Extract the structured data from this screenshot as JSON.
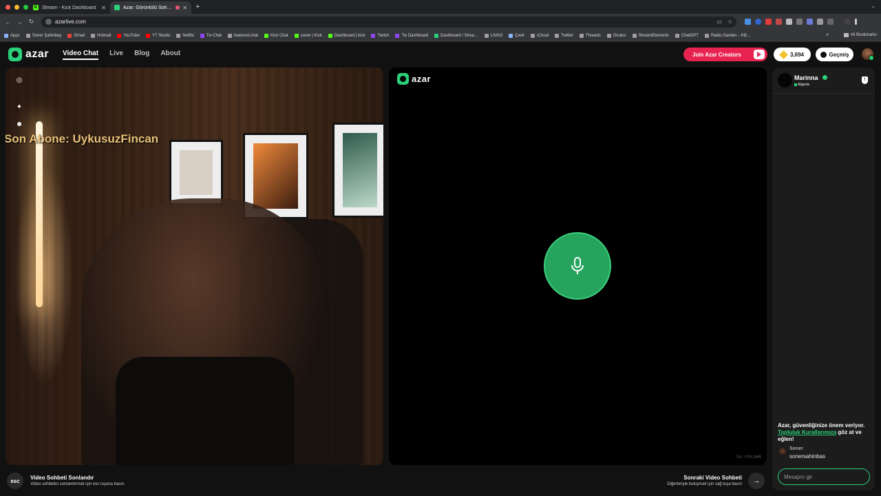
{
  "browser": {
    "tabs": [
      {
        "title": "Stream - Kick Dashboard",
        "favicon_color": "#53fc18",
        "favicon_letter": "K",
        "active": false
      },
      {
        "title": "Azar: Görüntülü Sohbet, Ar…",
        "favicon_color": "#2ad07a",
        "favicon_letter": "",
        "active": true
      }
    ],
    "new_tab": "+",
    "url": "azarlive.com",
    "bookmarks": [
      {
        "label": "Apps",
        "color": "#8ab4f8"
      },
      {
        "label": "Soner Şahinbaş",
        "color": "#9e9e9e"
      },
      {
        "label": "Gmail",
        "color": "#ea4335"
      },
      {
        "label": "Hotmail",
        "color": "#9e9e9e"
      },
      {
        "label": "YouTube",
        "color": "#ff0000"
      },
      {
        "label": "YT Studio",
        "color": "#ff0000"
      },
      {
        "label": "Netflix",
        "color": "#9e9e9e"
      },
      {
        "label": "Tw Chat",
        "color": "#9146ff"
      },
      {
        "label": "featured.chat",
        "color": "#9e9e9e"
      },
      {
        "label": "Kick Chat",
        "color": "#53fc18"
      },
      {
        "label": "soner | Kick",
        "color": "#53fc18"
      },
      {
        "label": "Dashboard | kick",
        "color": "#53fc18"
      },
      {
        "label": "Twitch",
        "color": "#9146ff"
      },
      {
        "label": "Tw Dashboard",
        "color": "#9146ff"
      },
      {
        "label": "Dashboard / Strea…",
        "color": "#2ad07a"
      },
      {
        "label": "LIVAO",
        "color": "#9e9e9e"
      },
      {
        "label": "Çevir",
        "color": "#8ab4f8"
      },
      {
        "label": "iCloud",
        "color": "#9e9e9e"
      },
      {
        "label": "Twitter",
        "color": "#9e9e9e"
      },
      {
        "label": "Threads",
        "color": "#9e9e9e"
      },
      {
        "label": "Oculus",
        "color": "#9e9e9e"
      },
      {
        "label": "StreamElements",
        "color": "#9e9e9e"
      },
      {
        "label": "ChatGPT",
        "color": "#9e9e9e"
      },
      {
        "label": "Radio Garden – KB…",
        "color": "#9e9e9e"
      }
    ],
    "more_bookmarks": "»",
    "all_bookmarks": "All Bookmarks"
  },
  "header": {
    "logo_text": "azar",
    "nav": [
      {
        "label": "Video Chat",
        "active": true
      },
      {
        "label": "Live",
        "active": false
      },
      {
        "label": "Blog",
        "active": false
      },
      {
        "label": "About",
        "active": false
      }
    ],
    "creators_label": "Join Azar Creators",
    "gems_count": "3,694",
    "history_label": "Geçmiş"
  },
  "left_video": {
    "overlay_text": "Son Abone: UykusuzFincan"
  },
  "right_video": {
    "watermark": "azar",
    "ident": "56:rP4L0#R"
  },
  "controls": {
    "esc_key": "esc",
    "end_title": "Video Sohbeti Sonlandır",
    "end_sub": "Video sohbetini sonlandırmak için esc tuşuna basın.",
    "next_title": "Sonraki Video Sohbeti",
    "next_sub": "Diğerleriyle buluşmak için sağ tuşa basın",
    "next_arrow": "→"
  },
  "chat": {
    "partner_name": "Marinna",
    "partner_country": "Algeria",
    "safety_prefix": "Azar, güvenliğinize önem veriyor.",
    "safety_link": "Topluluk Kurallarımıza",
    "safety_suffix": " göz at ve eğlen!",
    "message": {
      "name": "Soner",
      "text": "sonersahinbas"
    },
    "input_placeholder": "Mesajını gir"
  },
  "colors": {
    "accent": "#2ad07a",
    "creators": "#e8234f",
    "gem": "#f5c22c",
    "overlay_text": "#e8c27a"
  }
}
